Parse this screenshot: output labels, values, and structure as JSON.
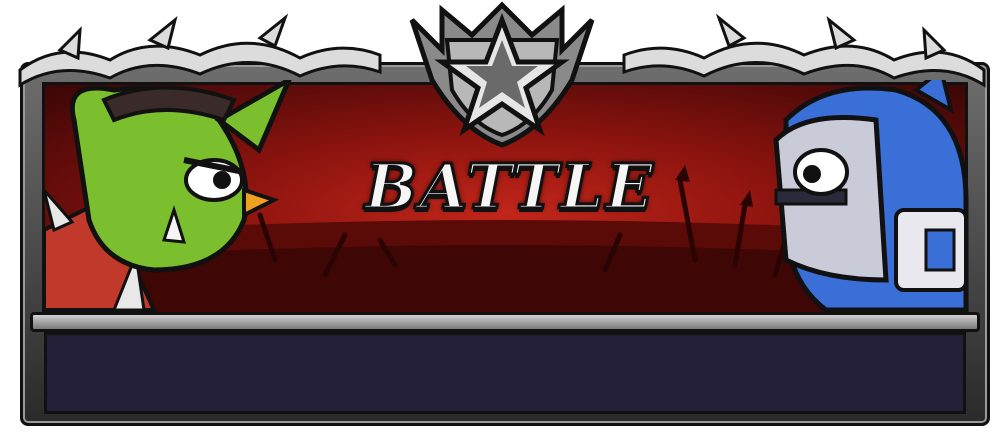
{
  "banner": {
    "title": "BATTLE",
    "colors": {
      "sky": "#8a130e",
      "glow": "#c2261a",
      "frame": "#6e6e6e",
      "footer": "#25203a",
      "goblin_skin": "#7bbf2e",
      "knight_armor": "#3a6fd8"
    },
    "icons": [
      "star-shield-icon",
      "vine-ornament-icon",
      "goblin-warrior-icon",
      "blue-knight-icon"
    ]
  }
}
